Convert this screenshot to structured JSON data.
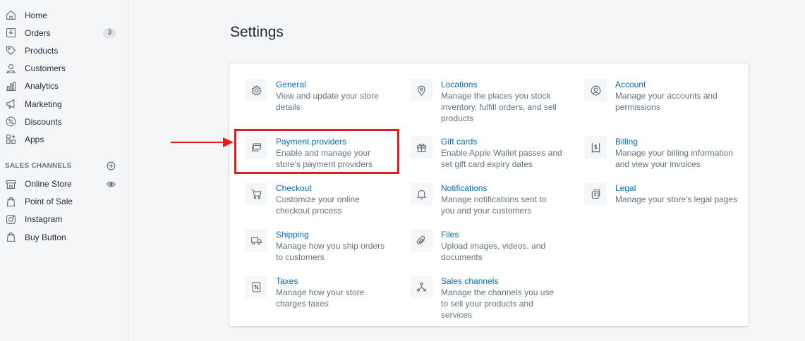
{
  "sidebar": {
    "nav": [
      {
        "label": "Home",
        "icon": "home-icon"
      },
      {
        "label": "Orders",
        "icon": "orders-icon",
        "badge": "3"
      },
      {
        "label": "Products",
        "icon": "tag-icon"
      },
      {
        "label": "Customers",
        "icon": "person-icon"
      },
      {
        "label": "Analytics",
        "icon": "bar-chart-icon"
      },
      {
        "label": "Marketing",
        "icon": "megaphone-icon"
      },
      {
        "label": "Discounts",
        "icon": "discount-icon"
      },
      {
        "label": "Apps",
        "icon": "apps-icon"
      }
    ],
    "sales_channels_heading": "SALES CHANNELS",
    "channels": [
      {
        "label": "Online Store",
        "icon": "store-icon"
      },
      {
        "label": "Point of Sale",
        "icon": "shopping-bag-icon"
      },
      {
        "label": "Instagram",
        "icon": "instagram-icon"
      },
      {
        "label": "Buy Button",
        "icon": "shopping-bag-icon"
      }
    ]
  },
  "main": {
    "title": "Settings",
    "settings": [
      {
        "title": "General",
        "desc": "View and update your store details",
        "icon": "gear-icon"
      },
      {
        "title": "Locations",
        "desc": "Manage the places you stock inventory, fulfill orders, and sell products",
        "icon": "location-pin-icon"
      },
      {
        "title": "Account",
        "desc": "Manage your accounts and permissions",
        "icon": "account-icon"
      },
      {
        "title": "Payment providers",
        "desc": "Enable and manage your store's payment providers",
        "icon": "payment-card-icon"
      },
      {
        "title": "Gift cards",
        "desc": "Enable Apple Wallet passes and set gift card expiry dates",
        "icon": "gift-icon"
      },
      {
        "title": "Billing",
        "desc": "Manage your billing information and view your invoices",
        "icon": "billing-icon"
      },
      {
        "title": "Checkout",
        "desc": "Customize your online checkout process",
        "icon": "cart-icon"
      },
      {
        "title": "Notifications",
        "desc": "Manage notifications sent to you and your customers",
        "icon": "bell-icon"
      },
      {
        "title": "Legal",
        "desc": "Manage your store's legal pages",
        "icon": "legal-icon"
      },
      {
        "title": "Shipping",
        "desc": "Manage how you ship orders to customers",
        "icon": "truck-icon"
      },
      {
        "title": "Files",
        "desc": "Upload images, videos, and documents",
        "icon": "paperclip-icon"
      },
      {
        "title": "Taxes",
        "desc": "Manage how your store charges taxes",
        "icon": "tax-icon"
      },
      {
        "title": "Sales channels",
        "desc": "Manage the channels you use to sell your products and services",
        "icon": "sales-channels-icon"
      }
    ]
  },
  "colors": {
    "link": "#006fbb",
    "annotation": "#e01c1c",
    "muted": "#637381"
  }
}
